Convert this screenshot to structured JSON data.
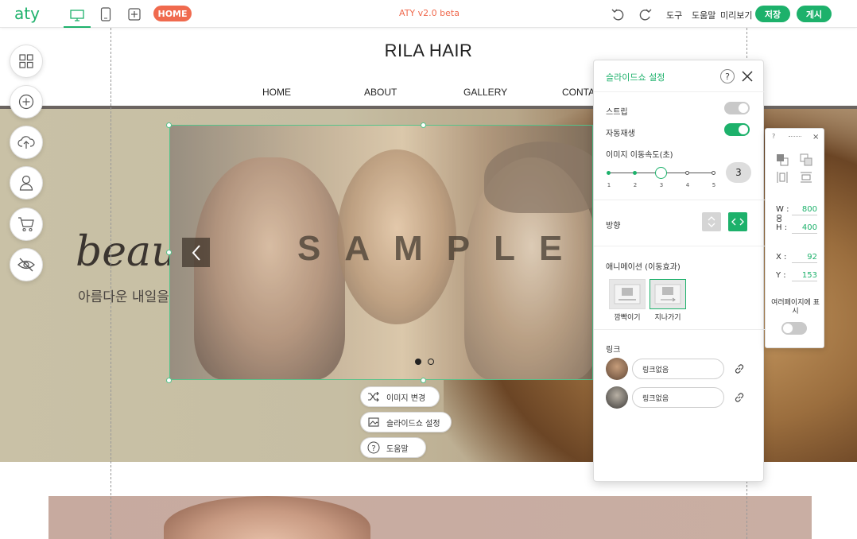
{
  "toolbar": {
    "logo": "aty",
    "home_label": "HOME",
    "app_title": "ATY v2.0 beta",
    "tools_label": "도구",
    "help_label": "도움말",
    "preview_label": "미리보기",
    "save_label": "저장",
    "publish_label": "게시"
  },
  "site": {
    "title": "RILA HAIR",
    "nav": [
      "HOME",
      "ABOUT",
      "GALLERY",
      "CONTAC"
    ],
    "hero_script": "beau",
    "hero_sub": "아름다운 내일을"
  },
  "slideshow": {
    "sample_text": "SAMPLE",
    "slide_count": 2,
    "active_slide": 1
  },
  "context_menu": {
    "change_image": "이미지 변경",
    "slideshow_settings": "슬라이드쇼 설정",
    "help": "도움말"
  },
  "panel": {
    "title": "슬라이드쇼 설정",
    "strip_label": "스트립",
    "strip_on": false,
    "autoplay_label": "자동재생",
    "autoplay_on": true,
    "speed_label": "이미지 이동속도(초)",
    "speed_steps": [
      "1",
      "2",
      "3",
      "4",
      "5"
    ],
    "speed_value": "3",
    "direction_label": "방향",
    "animation_label": "애니메이션 (이동효과)",
    "animation_options": [
      "깜빡이기",
      "지나가기"
    ],
    "animation_selected": "지나가기",
    "link_label": "링크",
    "links": [
      "링크없음",
      "링크없음"
    ]
  },
  "mini": {
    "help": "?",
    "close": "×",
    "w_label": "W :",
    "w_value": "800",
    "h_label": "H :",
    "h_value": "400",
    "x_label": "X :",
    "x_value": "92",
    "y_label": "Y :",
    "y_value": "153",
    "multi_page_label": "여러페이지에 표시",
    "multi_page_on": false
  },
  "colors": {
    "accent": "#1db16b",
    "home_pill": "#f06a4e"
  }
}
